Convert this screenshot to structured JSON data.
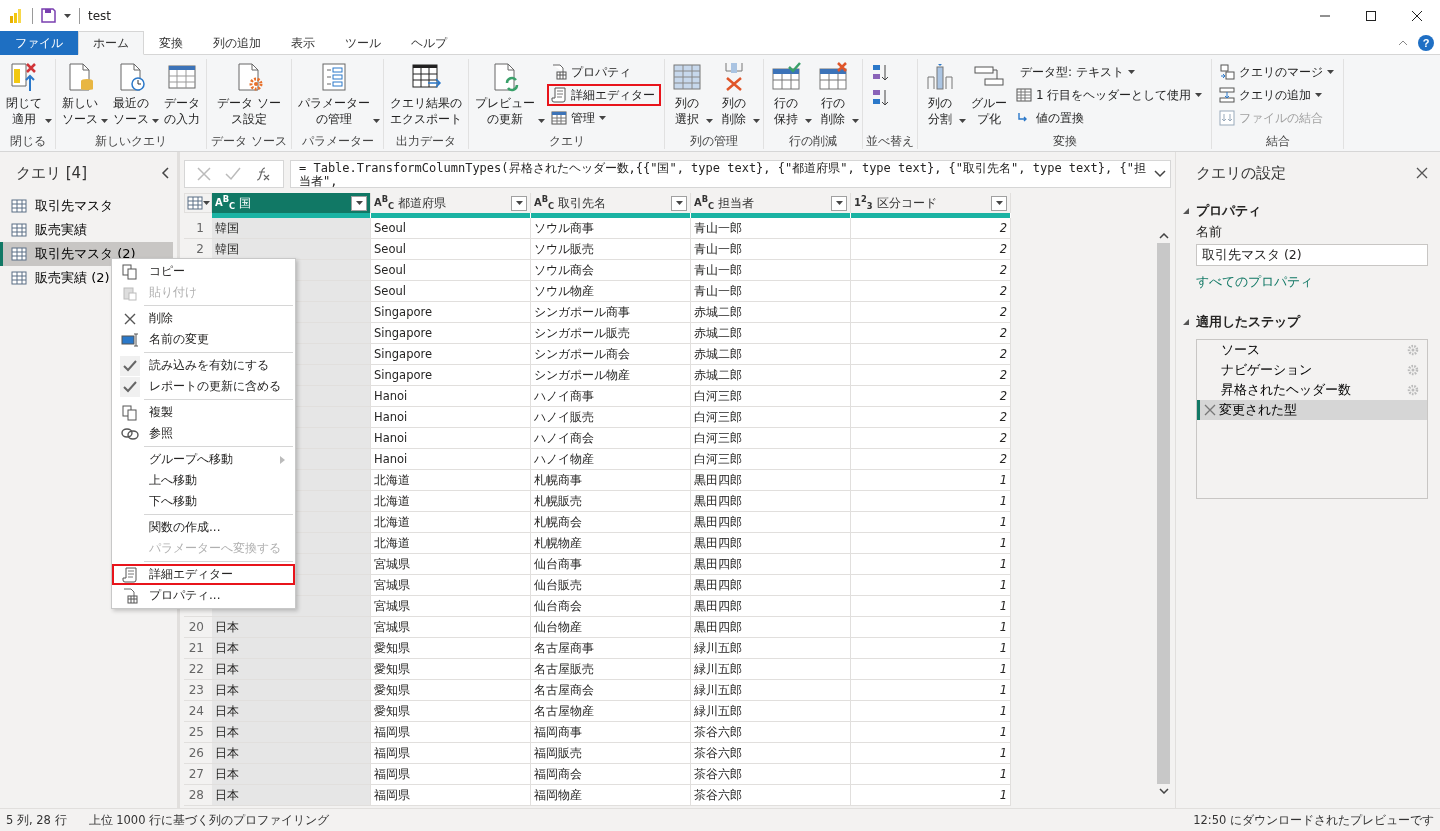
{
  "title_bar": {
    "title": "test"
  },
  "tabs": [
    {
      "label": "ファイル",
      "kind": "file",
      "selected": false
    },
    {
      "label": "ホーム",
      "kind": "tab",
      "selected": true
    },
    {
      "label": "変換",
      "kind": "tab",
      "selected": false
    },
    {
      "label": "列の追加",
      "kind": "tab",
      "selected": false
    },
    {
      "label": "表示",
      "kind": "tab",
      "selected": false
    },
    {
      "label": "ツール",
      "kind": "tab",
      "selected": false
    },
    {
      "label": "ヘルプ",
      "kind": "tab",
      "selected": false
    }
  ],
  "help_label": "?",
  "ribbon": [
    {
      "label": "閉じる",
      "buttons": [
        {
          "kind": "large",
          "label": "閉じて適用",
          "dropdown": true
        }
      ]
    },
    {
      "label": "新しいクエリ",
      "buttons": [
        {
          "kind": "large",
          "label": "新しいソース",
          "dropdown": true
        },
        {
          "kind": "large",
          "label": "最近のソース",
          "dropdown": true
        },
        {
          "kind": "large",
          "label": "データの入力",
          "dropdown": false
        }
      ]
    },
    {
      "label": "データ ソース",
      "buttons": [
        {
          "kind": "large",
          "label": "データ ソース設定",
          "dropdown": false
        }
      ]
    },
    {
      "label": "パラメーター",
      "buttons": [
        {
          "kind": "large",
          "label": "パラメーターの管理",
          "dropdown": true
        }
      ]
    },
    {
      "label": "出力データ",
      "buttons": [
        {
          "kind": "large",
          "label": "クエリ結果のエクスポート",
          "dropdown": false
        }
      ]
    },
    {
      "label": "クエリ",
      "buttons": [
        {
          "kind": "large",
          "label": "プレビューの更新",
          "dropdown": true
        },
        {
          "kind": "small",
          "label": "プロパティ",
          "dropdown": false,
          "highlighted": false,
          "disabled": false
        },
        {
          "kind": "small",
          "label": "詳細エディター",
          "dropdown": false,
          "highlighted": true,
          "disabled": false
        },
        {
          "kind": "small",
          "label": "管理",
          "dropdown": true,
          "highlighted": false,
          "disabled": false
        }
      ]
    },
    {
      "label": "列の管理",
      "buttons": [
        {
          "kind": "large",
          "label": "列の選択",
          "dropdown": true
        },
        {
          "kind": "large",
          "label": "列の削除",
          "dropdown": true
        }
      ]
    },
    {
      "label": "行の削減",
      "buttons": [
        {
          "kind": "large",
          "label": "行の保持",
          "dropdown": true
        },
        {
          "kind": "large",
          "label": "行の削除",
          "dropdown": true
        }
      ]
    },
    {
      "label": "並べ替え",
      "buttons": [
        {
          "kind": "icon"
        },
        {
          "kind": "icon"
        }
      ]
    },
    {
      "label": "変換",
      "buttons": [
        {
          "kind": "large",
          "label": "列の分割",
          "dropdown": true
        },
        {
          "kind": "large",
          "label": "グループ化",
          "dropdown": false
        },
        {
          "kind": "small",
          "label": "データ型: テキスト",
          "dropdown": true,
          "highlighted": false,
          "disabled": false
        },
        {
          "kind": "small",
          "label": "1 行目をヘッダーとして使用",
          "dropdown": true,
          "highlighted": false,
          "disabled": false
        },
        {
          "kind": "small",
          "label": "値の置換",
          "dropdown": false,
          "highlighted": false,
          "disabled": false
        }
      ]
    },
    {
      "label": "結合",
      "buttons": [
        {
          "kind": "small",
          "label": "クエリのマージ",
          "dropdown": true,
          "highlighted": false,
          "disabled": false
        },
        {
          "kind": "small",
          "label": "クエリの追加",
          "dropdown": true,
          "highlighted": false,
          "disabled": false
        },
        {
          "kind": "small",
          "label": "ファイルの結合",
          "dropdown": false,
          "highlighted": false,
          "disabled": true
        }
      ]
    }
  ],
  "queries": {
    "title": "クエリ [4]",
    "items": [
      {
        "label": "取引先マスタ",
        "selected": false
      },
      {
        "label": "販売実績",
        "selected": false
      },
      {
        "label": "取引先マスタ (2)",
        "selected": true
      },
      {
        "label": "販売実績 (2)",
        "selected": false
      }
    ]
  },
  "formula": "= Table.TransformColumnTypes(昇格されたヘッダー数,{{\"国\", type text}, {\"都道府県\", type text}, {\"取引先名\", type text}, {\"担当者\",",
  "table": {
    "columns": [
      {
        "type_icon": "A$^{B}$$_{C}$",
        "name": "国",
        "selected": true
      },
      {
        "type_icon": "A$^{B}$$_{C}$",
        "name": "都道府県",
        "selected": false
      },
      {
        "type_icon": "A$^{B}$$_{C}$",
        "name": "取引先名",
        "selected": false
      },
      {
        "type_icon": "A$^{B}$$_{C}$",
        "name": "担当者",
        "selected": false
      },
      {
        "type_icon": "1$^{2}$$_{3}$",
        "name": "区分コード",
        "selected": false
      }
    ],
    "rows": [
      {
        "number": "1",
        "cells": [
          "韓国",
          "Seoul",
          "ソウル商事",
          "青山一郎",
          "2"
        ]
      },
      {
        "number": "2",
        "cells": [
          "韓国",
          "Seoul",
          "ソウル販売",
          "青山一郎",
          "2"
        ]
      },
      {
        "cells": [
          "Seoul",
          "ソウル商会",
          "青山一郎",
          "2"
        ]
      },
      {
        "cells": [
          "Seoul",
          "ソウル物産",
          "青山一郎",
          "2"
        ]
      },
      {
        "cells": [
          "Singapore",
          "シンガポール商事",
          "赤城二郎",
          "2"
        ]
      },
      {
        "cells": [
          "Singapore",
          "シンガポール販売",
          "赤城二郎",
          "2"
        ]
      },
      {
        "cells": [
          "Singapore",
          "シンガポール商会",
          "赤城二郎",
          "2"
        ]
      },
      {
        "cells": [
          "Singapore",
          "シンガポール物産",
          "赤城二郎",
          "2"
        ]
      },
      {
        "cells": [
          "Hanoi",
          "ハノイ商事",
          "白河三郎",
          "2"
        ]
      },
      {
        "cells": [
          "Hanoi",
          "ハノイ販売",
          "白河三郎",
          "2"
        ]
      },
      {
        "cells": [
          "Hanoi",
          "ハノイ商会",
          "白河三郎",
          "2"
        ]
      },
      {
        "cells": [
          "Hanoi",
          "ハノイ物産",
          "白河三郎",
          "2"
        ]
      },
      {
        "cells": [
          "北海道",
          "札幌商事",
          "黒田四郎",
          "1"
        ]
      },
      {
        "cells": [
          "北海道",
          "札幌販売",
          "黒田四郎",
          "1"
        ]
      },
      {
        "cells": [
          "北海道",
          "札幌商会",
          "黒田四郎",
          "1"
        ]
      },
      {
        "cells": [
          "北海道",
          "札幌物産",
          "黒田四郎",
          "1"
        ]
      },
      {
        "cells": [
          "宮城県",
          "仙台商事",
          "黒田四郎",
          "1"
        ]
      },
      {
        "cells": [
          "宮城県",
          "仙台販売",
          "黒田四郎",
          "1"
        ]
      },
      {
        "cells": [
          "宮城県",
          "仙台商会",
          "黒田四郎",
          "1"
        ]
      },
      {
        "number": "20",
        "cells": [
          "日本",
          "宮城県",
          "仙台物産",
          "黒田四郎",
          "1"
        ]
      },
      {
        "number": "21",
        "cells": [
          "日本",
          "愛知県",
          "名古屋商事",
          "緑川五郎",
          "1"
        ]
      },
      {
        "number": "22",
        "cells": [
          "日本",
          "愛知県",
          "名古屋販売",
          "緑川五郎",
          "1"
        ]
      },
      {
        "number": "23",
        "cells": [
          "日本",
          "愛知県",
          "名古屋商会",
          "緑川五郎",
          "1"
        ]
      },
      {
        "number": "24",
        "cells": [
          "日本",
          "愛知県",
          "名古屋物産",
          "緑川五郎",
          "1"
        ]
      },
      {
        "number": "25",
        "cells": [
          "日本",
          "福岡県",
          "福岡商事",
          "茶谷六郎",
          "1"
        ]
      },
      {
        "number": "26",
        "cells": [
          "日本",
          "福岡県",
          "福岡販売",
          "茶谷六郎",
          "1"
        ]
      },
      {
        "number": "27",
        "cells": [
          "日本",
          "福岡県",
          "福岡商会",
          "茶谷六郎",
          "1"
        ]
      },
      {
        "number": "28",
        "cells": [
          "日本",
          "福岡県",
          "福岡物産",
          "茶谷六郎",
          "1"
        ]
      }
    ]
  },
  "context_menu": [
    [
      {
        "label": "コピー",
        "kind": "command",
        "disabled": false,
        "highlighted": false
      },
      {
        "label": "貼り付け",
        "kind": "command",
        "disabled": true,
        "highlighted": false
      }
    ],
    [
      {
        "label": "削除",
        "kind": "command",
        "disabled": false,
        "highlighted": false
      },
      {
        "label": "名前の変更",
        "kind": "command",
        "disabled": false,
        "highlighted": false
      }
    ],
    [
      {
        "label": "読み込みを有効にする",
        "kind": "toggle",
        "checked": true,
        "disabled": false,
        "highlighted": false
      },
      {
        "label": "レポートの更新に含める",
        "kind": "toggle",
        "checked": true,
        "disabled": false,
        "highlighted": false
      }
    ],
    [
      {
        "label": "複製",
        "kind": "command",
        "disabled": false,
        "highlighted": false
      },
      {
        "label": "参照",
        "kind": "command",
        "disabled": false,
        "highlighted": false
      }
    ],
    [
      {
        "label": "グループへ移動",
        "kind": "submenu",
        "disabled": false,
        "highlighted": false
      },
      {
        "label": "上へ移動",
        "kind": "command",
        "disabled": false,
        "highlighted": false
      },
      {
        "label": "下へ移動",
        "kind": "command",
        "disabled": false,
        "highlighted": false
      }
    ],
    [
      {
        "label": "関数の作成...",
        "kind": "command",
        "disabled": false,
        "highlighted": false
      },
      {
        "label": "パラメーターへ変換する",
        "kind": "command",
        "disabled": true,
        "highlighted": false
      }
    ],
    [
      {
        "label": "詳細エディター",
        "kind": "command",
        "disabled": false,
        "highlighted": true
      },
      {
        "label": "プロパティ...",
        "kind": "command",
        "disabled": false,
        "highlighted": false
      }
    ]
  ],
  "settings": {
    "title": "クエリの設定",
    "properties_heading": "プロパティ",
    "name_label": "名前",
    "name_value": "取引先マスタ (2)",
    "all_properties_link": "すべてのプロパティ",
    "steps_heading": "適用したステップ",
    "steps": [
      {
        "label": "ソース",
        "has_settings": true,
        "selected": false
      },
      {
        "label": "ナビゲーション",
        "has_settings": true,
        "selected": false
      },
      {
        "label": "昇格されたヘッダー数",
        "has_settings": true,
        "selected": false
      },
      {
        "label": "変更された型",
        "has_settings": false,
        "selected": true
      }
    ]
  },
  "status_bar": {
    "left": [
      "5 列, 28 行",
      "上位 1000 行に基づく列のプロファイリング"
    ],
    "right": "12:50 にダウンロードされたプレビューです"
  }
}
